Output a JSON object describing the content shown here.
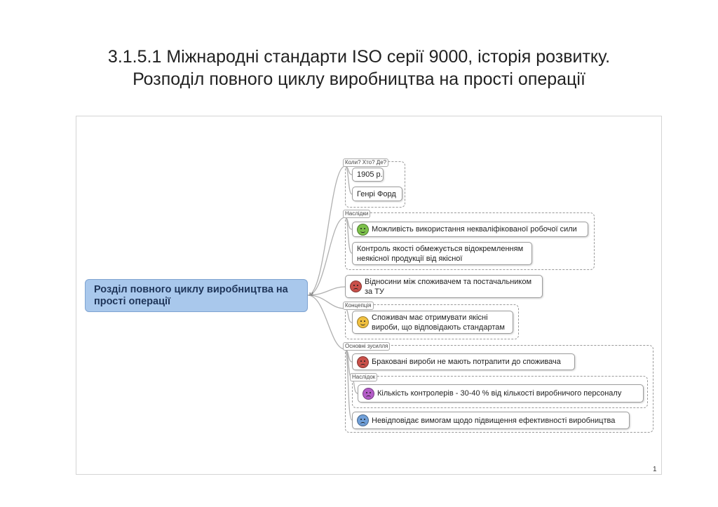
{
  "slide": {
    "title_line1": "3.1.5.1 Міжнародні стандарти ISO серії 9000, історія розвитку.",
    "title_line2": "Розподіл повного циклу виробництва на прості операції",
    "page_number": "1"
  },
  "mindmap": {
    "central": "Розділ повного циклу виробництва на прості операції",
    "group_labels": {
      "when": "Коли? Хто? Де?",
      "consequences": "Наслідки",
      "concept": "Концепція",
      "main_efforts": "Основні зусилля",
      "consequence_sub": "Наслідок"
    },
    "nodes": {
      "year": "1905 р.",
      "ford": "Генрі Форд",
      "unskilled": "Можливість використання некваліфікованої робочої сили",
      "quality_line1": "Контроль якості обмежується відокремленням",
      "quality_line2": "неякісної продукції від якісної",
      "relations_line1": "Відносини між споживачем та постачальником",
      "relations_line2": "за ТУ",
      "consumer_line1": "Споживач має отримувати якісні",
      "consumer_line2": "вироби, що відповідають стандартам",
      "defective": "Браковані вироби не мають потрапити до споживача",
      "controllers": "Кількість контролерів - 30-40 % від кількості виробничого персоналу",
      "efficiency": "Невідповідає вимогам щодо підвищення ефективності виробництва"
    },
    "emoji_colors": {
      "happy": "#7cc04a",
      "angry": "#c9504a",
      "laugh": "#f0c040",
      "purple": "#b45cc8",
      "blue": "#6f9fd8"
    },
    "central_color": "#a9c8ec"
  }
}
